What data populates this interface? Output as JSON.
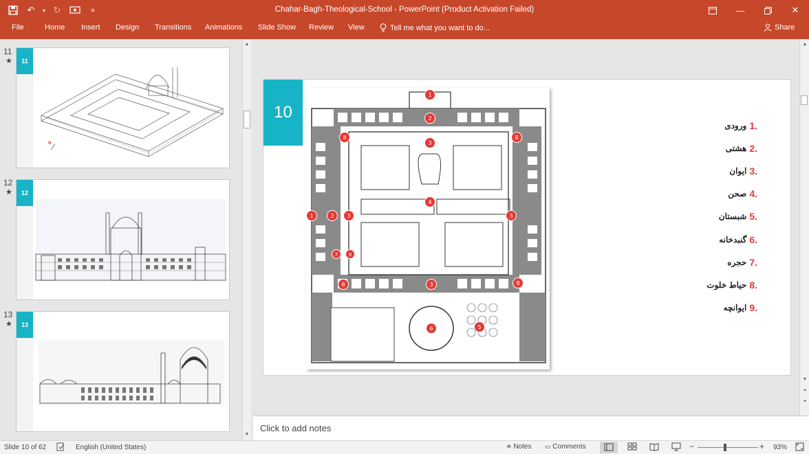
{
  "window": {
    "title": "Chahar-Bagh-Theological-School - PowerPoint (Product Activation Failed)"
  },
  "ribbon": {
    "file": "File",
    "tabs": [
      "Home",
      "Insert",
      "Design",
      "Transitions",
      "Animations",
      "Slide Show",
      "Review",
      "View"
    ],
    "tell_me": "Tell me what you want to do...",
    "share": "Share"
  },
  "thumbnails": [
    {
      "number": "11",
      "star": "★",
      "badge": "11"
    },
    {
      "number": "12",
      "star": "★",
      "badge": "12"
    },
    {
      "number": "13",
      "star": "★",
      "badge": "13"
    }
  ],
  "slide": {
    "number_badge": "10",
    "markers": [
      "1",
      "2",
      "3",
      "4",
      "5",
      "6",
      "7",
      "8",
      "9"
    ],
    "legend": [
      {
        "num": "1.",
        "text": "ورودی"
      },
      {
        "num": "2.",
        "text": "هشتی"
      },
      {
        "num": "3.",
        "text": "ایوان"
      },
      {
        "num": "4.",
        "text": "صحن"
      },
      {
        "num": "5.",
        "text": "شبستان"
      },
      {
        "num": "6.",
        "text": "گنبدخانه"
      },
      {
        "num": "7.",
        "text": "حجره"
      },
      {
        "num": "8.",
        "text": "حیاط خلوت"
      },
      {
        "num": "9.",
        "text": "ایوانچه"
      }
    ]
  },
  "notes": {
    "placeholder": "Click to add notes"
  },
  "status": {
    "slide_info": "Slide 10 of 62",
    "language": "English (United States)",
    "notes_btn": "Notes",
    "comments_btn": "Comments",
    "zoom": "93%"
  },
  "colors": {
    "accent": "#c6472a",
    "teal": "#17b3c6",
    "marker_red": "#e53935"
  }
}
